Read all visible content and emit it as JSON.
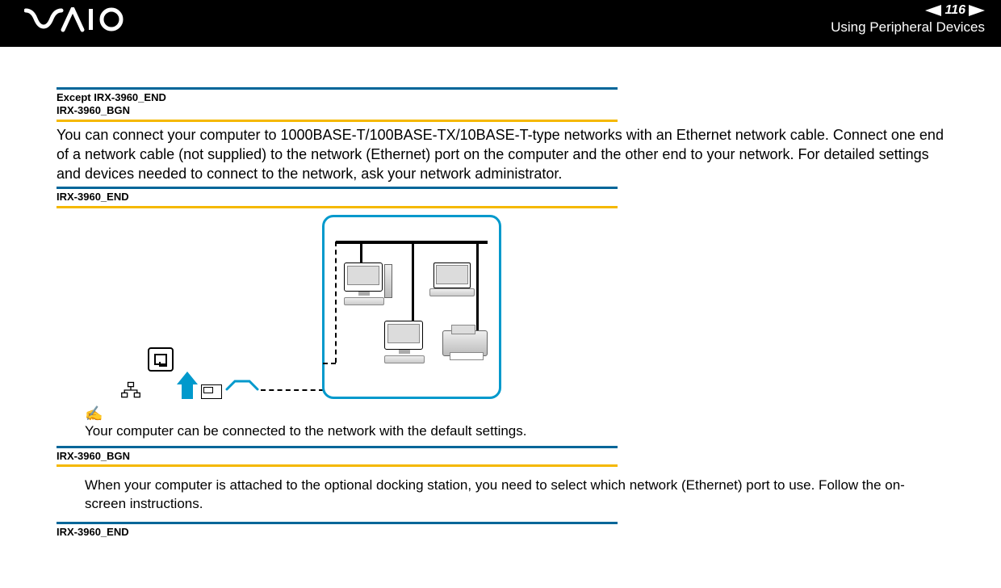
{
  "header": {
    "logo_alt": "VAIO",
    "page_number": "116",
    "section_title": "Using Peripheral Devices"
  },
  "tags": {
    "t1_line1": "Except IRX-3960_END",
    "t1_line2": "IRX-3960_BGN",
    "t2": "IRX-3960_END",
    "t3": "IRX-3960_BGN",
    "t4": "IRX-3960_END"
  },
  "body": {
    "p1": "You can connect your computer to 1000BASE-T/100BASE-TX/10BASE-T-type networks with an Ethernet network cable. Connect one end of a network cable (not supplied) to the network (Ethernet) port on the computer and the other end to your network. For detailed settings and devices needed to connect to the network, ask your network administrator.",
    "note_icon": "✍",
    "note": "Your computer can be connected to the network with the default settings.",
    "p2": "When your computer is attached to the optional docking station, you need to select which network (Ethernet) port to use. Follow the on-screen instructions."
  }
}
